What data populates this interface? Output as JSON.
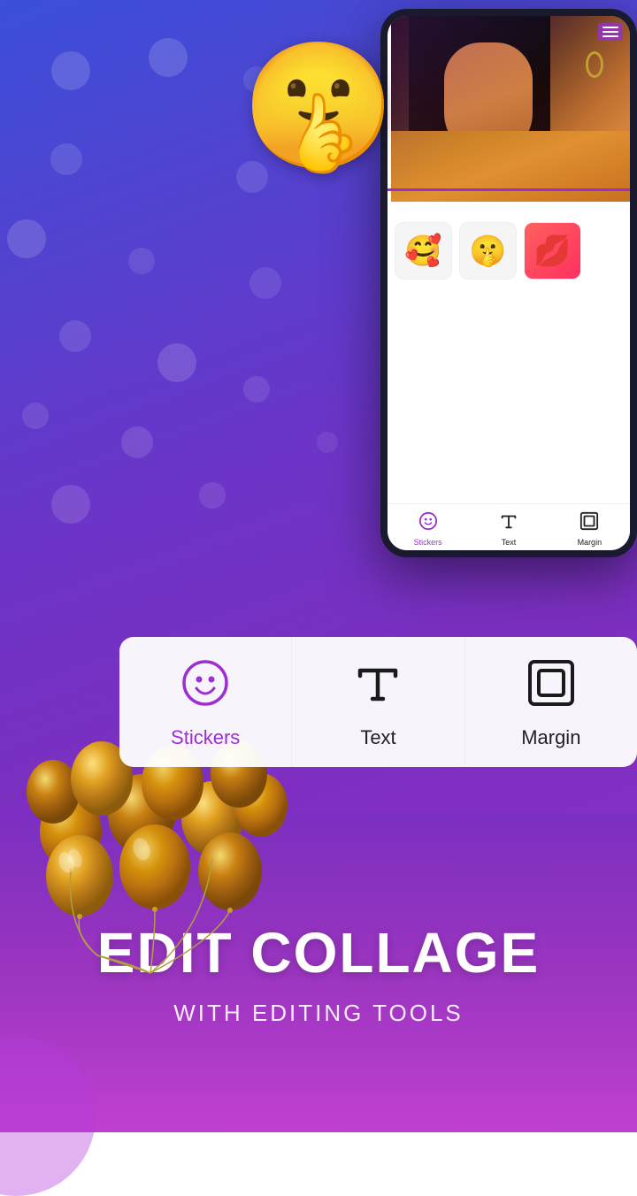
{
  "background": {
    "gradient_start": "#3b4fd8",
    "gradient_end": "#8b2fc9"
  },
  "phone": {
    "menu_icon": "☰",
    "stickers": [
      {
        "emoji": "😊",
        "label": "smiling face with hearts"
      },
      {
        "emoji": "🤫",
        "label": "shushing face"
      }
    ],
    "toolbar": {
      "items": [
        {
          "icon": "stickers",
          "label": "Stickers",
          "active": true
        },
        {
          "icon": "text",
          "label": "Text",
          "active": false
        },
        {
          "icon": "margin",
          "label": "Margin",
          "active": false
        }
      ]
    }
  },
  "emoji_overlay": {
    "emoji": "🤫",
    "label": "shushing face emoji"
  },
  "main_toolbar": {
    "items": [
      {
        "id": "stickers",
        "icon": "smiley",
        "label": "Stickers",
        "active": true
      },
      {
        "id": "text",
        "icon": "T",
        "label": "Text",
        "active": false
      },
      {
        "id": "margin",
        "icon": "margin",
        "label": "Margin",
        "active": false
      }
    ]
  },
  "bottom_section": {
    "title": "EDIT COLLAGE",
    "subtitle": "WITH EDITING TOOLS"
  }
}
